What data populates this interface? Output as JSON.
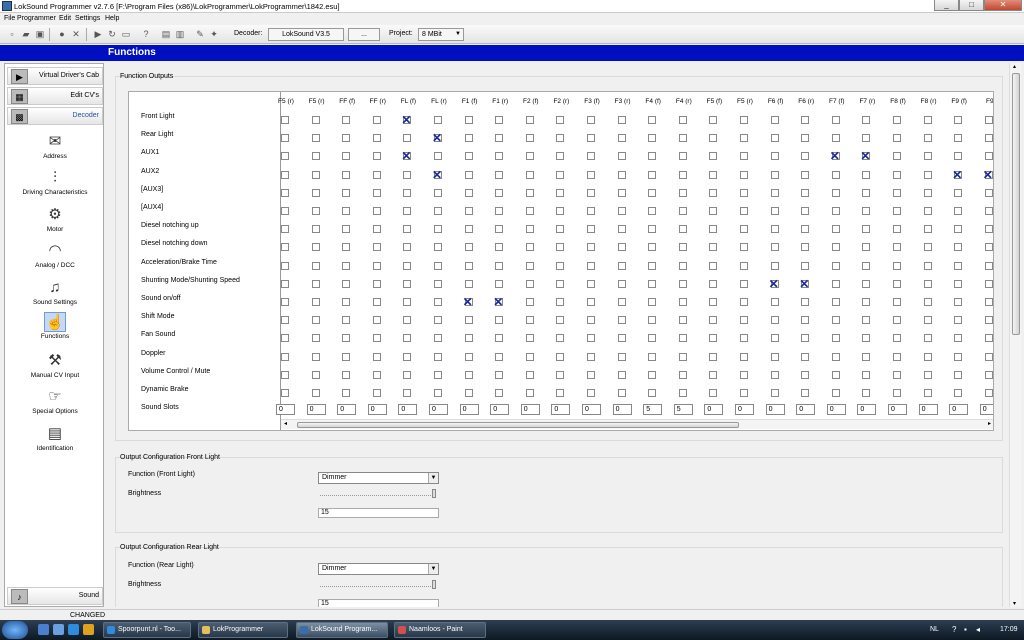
{
  "window": {
    "title": "LokSound Programmer   v2.7.6  [F:\\Program Files (x86)\\LokProgrammer\\LokProgrammer\\1842.esu]",
    "min": "_",
    "max": "□",
    "close": "✕"
  },
  "menu": [
    "File",
    "Programmer",
    "Edit",
    "Settings",
    "Help"
  ],
  "toolbar": {
    "decoder_label": "Decoder:",
    "decoder_value": "LokSound V3.5",
    "decoder_btn": "...",
    "project_label": "Project:",
    "project_value": "8 MBit"
  },
  "banner": {
    "title": "Functions"
  },
  "sidebar": {
    "tabs": [
      {
        "label": "Virtual Driver's Cab"
      },
      {
        "label": "Edit CV's"
      },
      {
        "label": "Decoder"
      }
    ],
    "nav": [
      {
        "label": "Address",
        "icon": "envelope-icon"
      },
      {
        "label": "Driving Characteristics",
        "icon": "sliders-icon"
      },
      {
        "label": "Motor",
        "icon": "motor-icon"
      },
      {
        "label": "Analog / DCC",
        "icon": "analog-dcc-icon"
      },
      {
        "label": "Sound Settings",
        "icon": "music-notes-icon"
      },
      {
        "label": "Functions",
        "icon": "functions-hand-icon"
      },
      {
        "label": "Manual CV Input",
        "icon": "wrench-icon"
      },
      {
        "label": "Special Options",
        "icon": "special-options-icon"
      },
      {
        "label": "Identification",
        "icon": "id-card-icon"
      }
    ],
    "bottom_tab": {
      "label": "Sound"
    }
  },
  "function_outputs": {
    "title": "Function Outputs",
    "columns": [
      "F5 (r)",
      "F5 (r)",
      "FF (f)",
      "FF (r)",
      "FL (f)",
      "FL (r)",
      "F1 (f)",
      "F1 (r)",
      "F2 (f)",
      "F2 (r)",
      "F3 (f)",
      "F3 (r)",
      "F4 (f)",
      "F4 (r)",
      "F5 (f)",
      "F5 (r)",
      "F6 (f)",
      "F6 (r)",
      "F7 (f)",
      "F7 (r)",
      "F8 (f)",
      "F8 (r)",
      "F9 (f)",
      "F9"
    ],
    "rows": [
      "Front Light",
      "Rear Light",
      "AUX1",
      "AUX2",
      "[AUX3]",
      "[AUX4]",
      "Diesel notching up",
      "Diesel notching down",
      "Acceleration/Brake Time",
      "Shunting Mode/Shunting Speed",
      "Sound on/off",
      "Shift Mode",
      "Fan Sound",
      "Doppler",
      "Volume Control / Mute",
      "Dynamic Brake",
      "Sound Slots"
    ],
    "checked": [
      [
        0,
        4
      ],
      [
        1,
        5
      ],
      [
        2,
        4
      ],
      [
        2,
        18
      ],
      [
        2,
        19
      ],
      [
        3,
        5
      ],
      [
        3,
        22
      ],
      [
        3,
        23
      ],
      [
        9,
        16
      ],
      [
        9,
        17
      ],
      [
        10,
        6
      ],
      [
        10,
        7
      ]
    ],
    "sound_slots": [
      "0",
      "0",
      "0",
      "0",
      "0",
      "0",
      "0",
      "0",
      "0",
      "0",
      "0",
      "0",
      "5",
      "5",
      "0",
      "0",
      "0",
      "0",
      "0",
      "0",
      "0",
      "0",
      "0",
      "0"
    ]
  },
  "front_light": {
    "title": "Output Configuration Front Light",
    "function_label": "Function (Front Light)",
    "function_value": "Dimmer",
    "brightness_label": "Brightness",
    "brightness_value": "15",
    "brightness_fraction": 1.0
  },
  "rear_light": {
    "title": "Output Configuration Rear Light",
    "function_label": "Function (Rear Light)",
    "function_value": "Dimmer",
    "brightness_label": "Brightness",
    "brightness_value": "15",
    "brightness_fraction": 1.0
  },
  "status": {
    "text": "CHANGED"
  },
  "taskbar": {
    "tasks": [
      {
        "label": "Spoorpunt.nl - Too..."
      },
      {
        "label": "LokProgrammer"
      },
      {
        "label": "LokSound Program..."
      },
      {
        "label": "Naamloos - Paint"
      }
    ],
    "lang": "NL",
    "time": "17:09"
  }
}
